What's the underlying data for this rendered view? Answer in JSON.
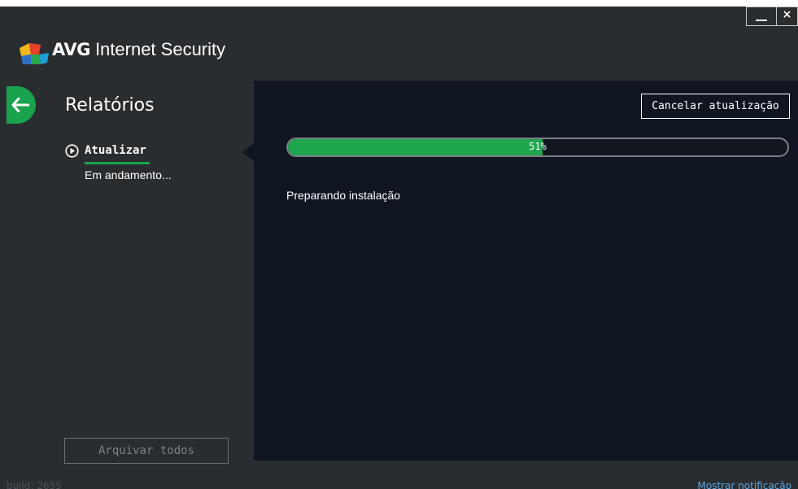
{
  "app": {
    "brand": "AVG",
    "product": " Internet Security"
  },
  "window_controls": {
    "close": "×"
  },
  "left_panel": {
    "title": "Relatórios",
    "report": {
      "title": "Atualizar",
      "status": "Em andamento..."
    },
    "archive_button": "Arquivar todos"
  },
  "main": {
    "cancel_button": "Cancelar atualização",
    "progress": {
      "percent": 51,
      "label": "51%"
    },
    "status": "Preparando instalação"
  },
  "footer": {
    "build": "build: 2655",
    "notification_link": "Mostrar notificação"
  },
  "colors": {
    "accent_green": "#19a34c",
    "window_bg": "#2a2d30",
    "main_bg": "#0f1521",
    "link": "#5aa7e0"
  }
}
